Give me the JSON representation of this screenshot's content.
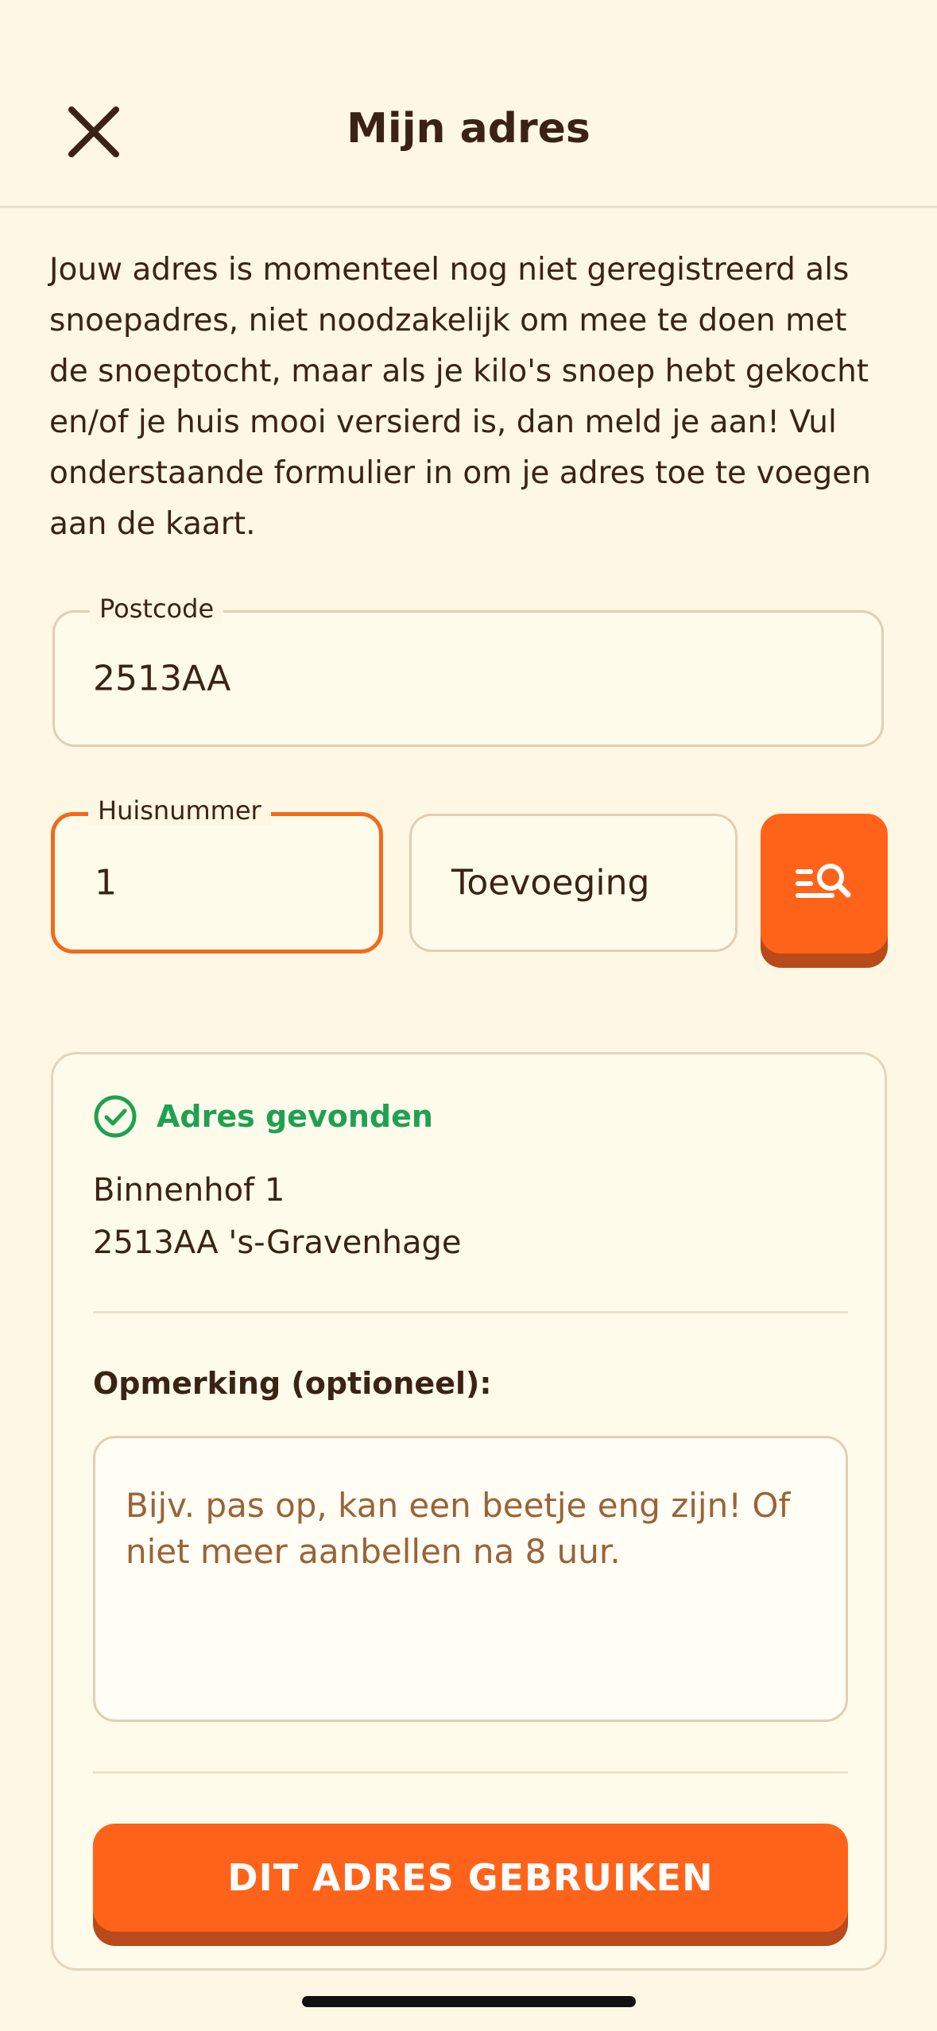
{
  "header": {
    "title": "Mijn adres",
    "close_icon": "close-icon"
  },
  "intro_text": "Jouw adres is momenteel nog niet geregistreerd als snoepadres, niet noodzakelijk om mee te doen met de snoeptocht, maar als je kilo's snoep hebt gekocht en/of je huis mooi versierd is, dan meld je aan! Vul onderstaande formulier in om je adres toe te voegen aan de kaart.",
  "form": {
    "postcode": {
      "label": "Postcode",
      "value": "2513AA"
    },
    "huisnummer": {
      "label": "Huisnummer",
      "value": "1"
    },
    "toevoeging": {
      "placeholder": "Toevoeging"
    },
    "search_icon": "list-search-icon"
  },
  "result": {
    "status_icon": "check-circle-icon",
    "status_label": "Adres gevonden",
    "street": "Binnenhof 1",
    "city_line": "2513AA 's-Gravenhage",
    "remark_label": "Opmerking (optioneel):",
    "remark_placeholder": "Bijv. pas op, kan een beetje eng zijn! Of niet meer aanbellen na 8 uur.",
    "submit_label": "DIT ADRES GEBRUIKEN"
  },
  "colors": {
    "background": "#fdf7e3",
    "accent": "#ff6319",
    "accent_shadow": "#b84a1b",
    "success": "#1fa052",
    "text": "#3b2314",
    "placeholder": "#9a6338"
  }
}
